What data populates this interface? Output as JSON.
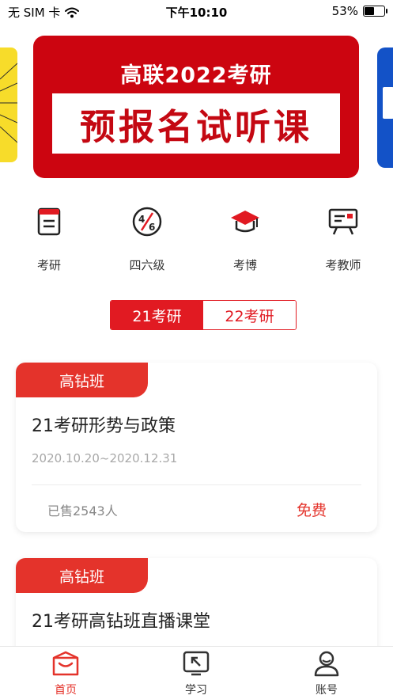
{
  "status_bar": {
    "carrier": "无 SIM 卡",
    "time": "下午10:10",
    "battery": "53%",
    "battery_level": 0.53
  },
  "banner": {
    "title": "高联2022考研",
    "subtitle": "预报名试听课"
  },
  "categories": [
    {
      "label": "考研",
      "icon": "notebook-icon"
    },
    {
      "label": "四六级",
      "icon": "four-six-icon"
    },
    {
      "label": "考博",
      "icon": "graduation-cap-icon"
    },
    {
      "label": "考教师",
      "icon": "presentation-board-icon"
    }
  ],
  "segment": {
    "tabs": [
      "21考研",
      "22考研"
    ],
    "selected": 0
  },
  "courses": [
    {
      "tag": "高钻班",
      "title": "21考研形势与政策",
      "date": "2020.10.20~2020.12.31",
      "sold": "已售2543人",
      "price": "免费"
    },
    {
      "tag": "高钻班",
      "title": "21考研高钻班直播课堂"
    }
  ],
  "tabbar": {
    "items": [
      {
        "label": "首页",
        "icon": "home-icon"
      },
      {
        "label": "学习",
        "icon": "study-icon"
      },
      {
        "label": "账号",
        "icon": "account-icon"
      }
    ],
    "selected": 0
  },
  "colors": {
    "accent": "#e11a22",
    "tag": "#e4332b",
    "banner": "#cc0510"
  }
}
